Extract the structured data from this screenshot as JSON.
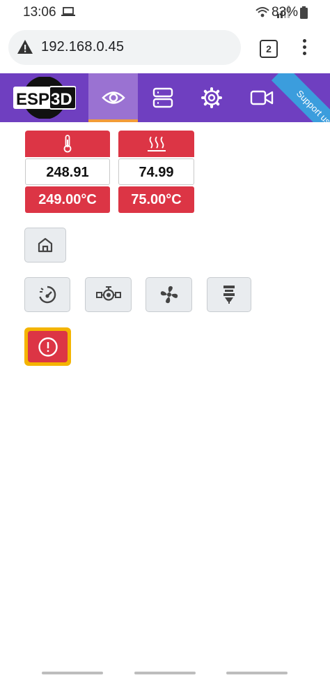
{
  "status_bar": {
    "time": "13:06",
    "battery": "83%"
  },
  "browser": {
    "url": "192.168.0.45",
    "tab_count": "2"
  },
  "navbar": {
    "logo": "ESP3D",
    "ribbon": "Support us",
    "colors": {
      "bar": "#6f3fc0",
      "active": "#9a72d2",
      "underline": "#f29c38"
    }
  },
  "temperatures": [
    {
      "icon": "thermometer-icon",
      "current": "248.91",
      "target": "249.00°C"
    },
    {
      "icon": "heated-bed-icon",
      "current": "74.99",
      "target": "75.00°C"
    }
  ],
  "controls": {
    "row1": [
      "home-icon"
    ],
    "row2": [
      "speedometer-icon",
      "flow-valve-icon",
      "fan-icon",
      "extruder-icon"
    ],
    "estop": "alert-circle-icon"
  },
  "colors": {
    "danger": "#dc3545",
    "warning": "#f4b400"
  }
}
